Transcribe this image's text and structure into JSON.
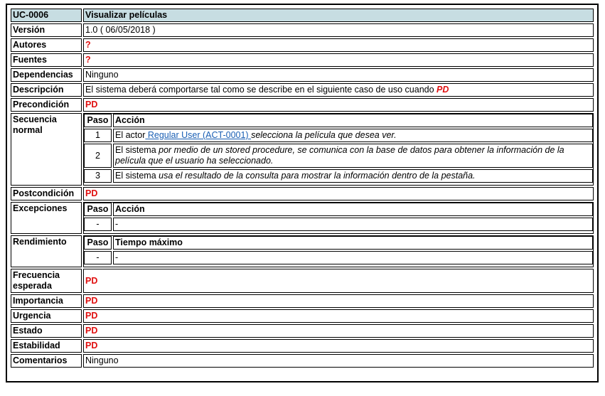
{
  "header": {
    "id": "UC-0006",
    "title": "Visualizar películas"
  },
  "version": {
    "label": "Versión",
    "value": "1.0 ( 06/05/2018 )"
  },
  "autores": {
    "label": "Autores",
    "value": "?"
  },
  "fuentes": {
    "label": "Fuentes",
    "value": "?"
  },
  "dependencias": {
    "label": "Dependencias",
    "value": "Ninguno"
  },
  "descripcion": {
    "label": "Descripción",
    "value": "El sistema deberá comportarse tal como se describe en el siguiente caso de uso cuando",
    "tag": "PD"
  },
  "precondicion": {
    "label": "Precondición",
    "value": "PD"
  },
  "secuencia": {
    "label": "Secuencia normal",
    "col_paso": "Paso",
    "col_accion": "Acción",
    "steps": [
      {
        "num": "1",
        "pre": "El actor",
        "link": " Regular User (ACT-0001) ",
        "post": "selecciona la película que desea ver."
      },
      {
        "num": "2",
        "pre": "El sistema",
        "text": " por medio de un stored procedure, se comunica con la base de datos para obtener la información de la película que el usuario ha seleccionado."
      },
      {
        "num": "3",
        "pre": "El sistema",
        "text": " usa el resultado de la consulta para mostrar la información dentro de la pestaña."
      }
    ]
  },
  "postcondicion": {
    "label": "Postcondición",
    "value": "PD"
  },
  "excepciones": {
    "label": "Excepciones",
    "col_paso": "Paso",
    "col_accion": "Acción",
    "row": {
      "paso": "-",
      "accion": "-"
    }
  },
  "rendimiento": {
    "label": "Rendimiento",
    "col_paso": "Paso",
    "col_tiempo": "Tiempo máximo",
    "row": {
      "paso": "-",
      "tiempo": "-"
    }
  },
  "frecuencia": {
    "label": "Frecuencia esperada",
    "value": "PD"
  },
  "importancia": {
    "label": "Importancia",
    "value": "PD"
  },
  "urgencia": {
    "label": "Urgencia",
    "value": "PD"
  },
  "estado": {
    "label": "Estado",
    "value": "PD"
  },
  "estabilidad": {
    "label": "Estabilidad",
    "value": "PD"
  },
  "comentarios": {
    "label": "Comentarios",
    "value": "Ninguno"
  },
  "colors": {
    "header_bg": "#c7dde2",
    "pd_red": "#e01010",
    "link_blue": "#1a5fb4"
  }
}
